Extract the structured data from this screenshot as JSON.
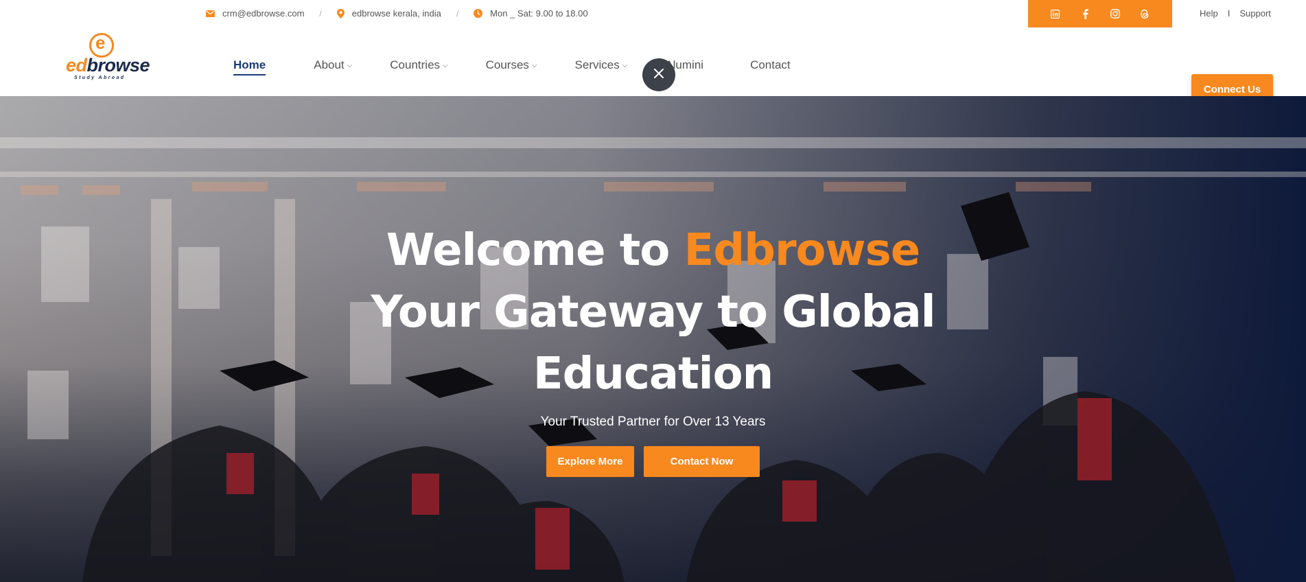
{
  "topbar": {
    "email": "crm@edbrowse.com",
    "location": "edbrowse kerala, india",
    "hours": "Mon _ Sat: 9.00 to 18.00",
    "separator": "/",
    "social": [
      "linkedin-icon",
      "facebook-icon",
      "instagram-icon",
      "threads-icon"
    ],
    "help": "Help",
    "divider": "I",
    "support": "Support"
  },
  "logo": {
    "ed": "ed",
    "browse": "browse",
    "tagline": "Study Abroad"
  },
  "nav": {
    "items": [
      {
        "label": "Home",
        "active": true
      },
      {
        "label": "About",
        "dropdown": true
      },
      {
        "label": "Countries",
        "dropdown": true
      },
      {
        "label": "Courses",
        "dropdown": true
      },
      {
        "label": "Services",
        "dropdown": true
      },
      {
        "label": "Alumini"
      },
      {
        "label": "Contact"
      }
    ],
    "chevron": "⌄",
    "connect": "Connect Us"
  },
  "hero": {
    "title_prefix": "Welcome to ",
    "title_accent": "Edbrowse",
    "title_line2": "Your Gateway to Global",
    "title_line3": "Education",
    "subtitle": "Your Trusted Partner for Over 13 Years",
    "btn_explore": "Explore More",
    "btn_contact": "Contact Now"
  },
  "colors": {
    "accent": "#f7891f",
    "navy": "#1b2a4a",
    "active_nav": "#1b3a78",
    "hero_overlay": "#0e1a3a"
  }
}
